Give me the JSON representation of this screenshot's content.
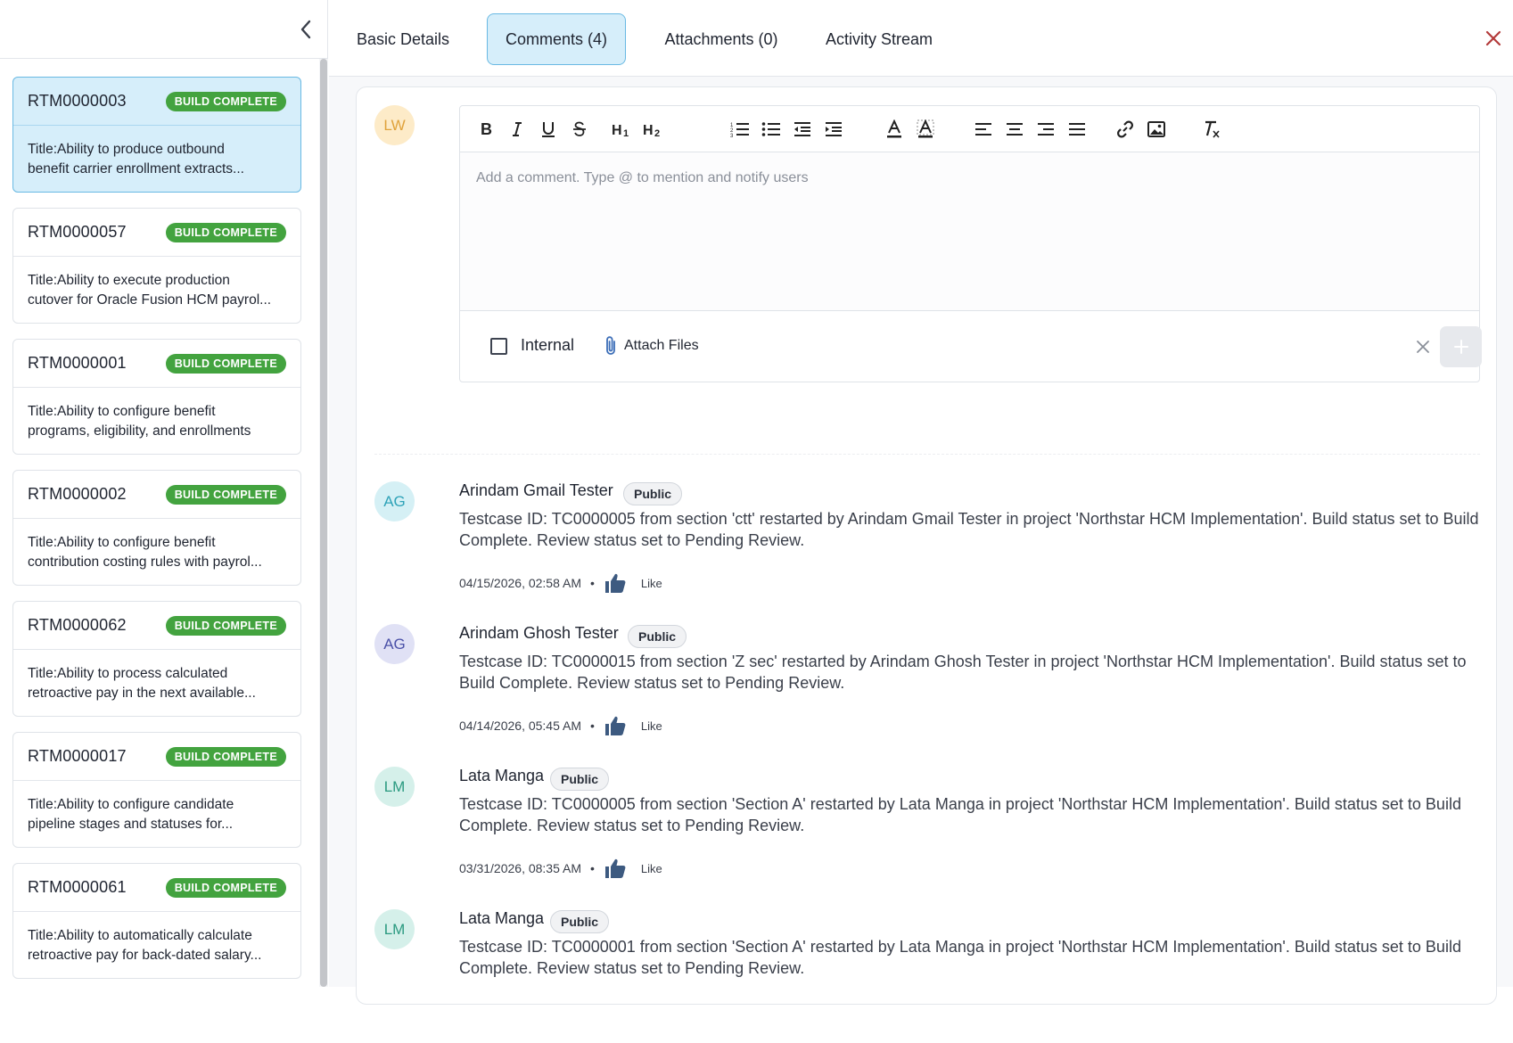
{
  "sidebar": {
    "cards": [
      {
        "id": "RTM0000003",
        "status": "BUILD COMPLETE",
        "title_line1": "Title:Ability to produce outbound",
        "title_line2": "benefit carrier enrollment extracts..."
      },
      {
        "id": "RTM0000057",
        "status": "BUILD COMPLETE",
        "title_line1": "Title:Ability to execute production",
        "title_line2": "cutover for Oracle Fusion HCM payrol..."
      },
      {
        "id": "RTM0000001",
        "status": "BUILD COMPLETE",
        "title_line1": "Title:Ability to configure benefit",
        "title_line2": "programs, eligibility, and enrollments"
      },
      {
        "id": "RTM0000002",
        "status": "BUILD COMPLETE",
        "title_line1": "Title:Ability to configure benefit",
        "title_line2": "contribution costing rules with payrol..."
      },
      {
        "id": "RTM0000062",
        "status": "BUILD COMPLETE",
        "title_line1": "Title:Ability to process calculated",
        "title_line2": "retroactive pay in the next available..."
      },
      {
        "id": "RTM0000017",
        "status": "BUILD COMPLETE",
        "title_line1": "Title:Ability to configure candidate",
        "title_line2": "pipeline stages and statuses for..."
      },
      {
        "id": "RTM0000061",
        "status": "BUILD COMPLETE",
        "title_line1": "Title:Ability to automatically calculate",
        "title_line2": "retroactive pay for back-dated salary..."
      }
    ]
  },
  "tabs": {
    "basic": "Basic Details",
    "comments": "Comments (4)",
    "attachments": "Attachments (0)",
    "activity": "Activity Stream"
  },
  "editor": {
    "user_initials": "LW",
    "placeholder": "Add a comment. Type @ to mention and notify users",
    "internal_label": "Internal",
    "attach_label": "Attach Files"
  },
  "comments": [
    {
      "initials": "AG",
      "author": "Arindam Gmail Tester",
      "visibility": "Public",
      "text": "Testcase ID: TC0000005 from section 'ctt' restarted by Arindam Gmail Tester in project 'Northstar HCM Implementation'. Build status set to Build Complete. Review status set to Pending Review.",
      "timestamp": "04/15/2026, 02:58 AM",
      "like_label": "Like"
    },
    {
      "initials": "AG",
      "author": "Arindam Ghosh Tester",
      "visibility": "Public",
      "text": "Testcase ID: TC0000015 from section 'Z sec' restarted by Arindam Ghosh Tester in project 'Northstar HCM Implementation'. Build status set to Build Complete. Review status set to Pending Review.",
      "timestamp": "04/14/2026, 05:45 AM",
      "like_label": "Like"
    },
    {
      "initials": "LM",
      "author": "Lata Manga",
      "visibility": "Public",
      "text": "Testcase ID: TC0000005 from section 'Section A' restarted by Lata Manga in project 'Northstar HCM Implementation'. Build status set to Build Complete. Review status set to Pending Review.",
      "timestamp": "03/31/2026, 08:35 AM",
      "like_label": "Like"
    },
    {
      "initials": "LM",
      "author": "Lata Manga",
      "visibility": "Public",
      "text": "Testcase ID: TC0000001 from section 'Section A' restarted by Lata Manga in project 'Northstar HCM Implementation'. Build status set to Build Complete. Review status set to Pending Review.",
      "timestamp": "",
      "like_label": ""
    }
  ],
  "colors": {
    "accent": "#69b9e3",
    "active_bg": "#d6eefa",
    "badge_green": "#43a33f",
    "close_red": "#c0392b",
    "like_blue": "#3d5a80"
  }
}
